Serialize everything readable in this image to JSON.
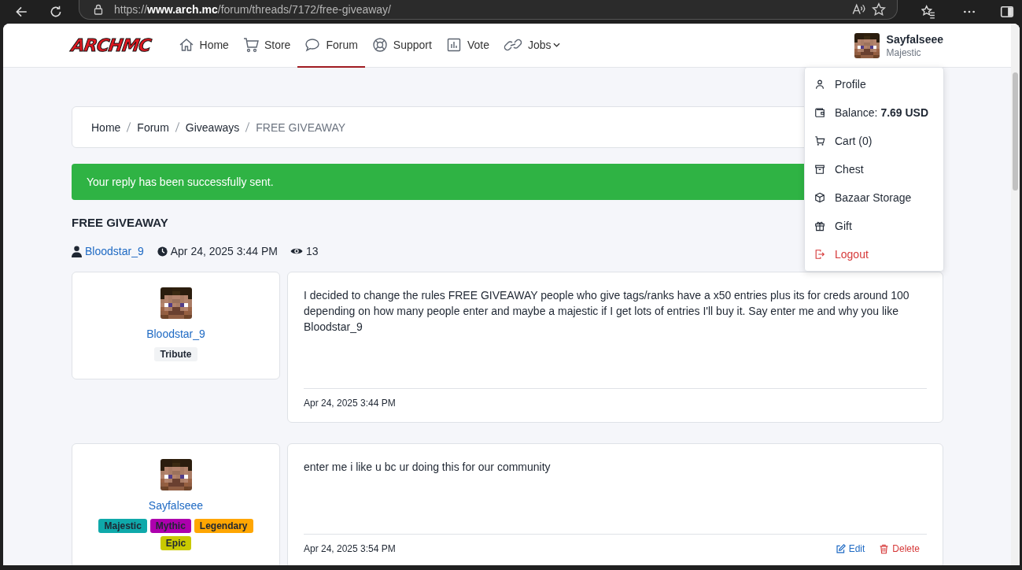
{
  "browser": {
    "url_scheme": "https://",
    "url_host": "www.arch.mc",
    "url_path": "/forum/threads/7172/free-giveaway/"
  },
  "nav": {
    "logo": "ARCHMC",
    "items": [
      {
        "label": "Home",
        "selected": false,
        "has_menu": false
      },
      {
        "label": "Store",
        "selected": false,
        "has_menu": false
      },
      {
        "label": "Forum",
        "selected": true,
        "has_menu": false
      },
      {
        "label": "Support",
        "selected": false,
        "has_menu": false
      },
      {
        "label": "Vote",
        "selected": false,
        "has_menu": false
      },
      {
        "label": "Jobs",
        "selected": false,
        "has_menu": true
      }
    ],
    "user": {
      "name": "Sayfalseee",
      "rank": "Majestic"
    }
  },
  "user_menu": [
    {
      "label": "Profile",
      "kind": "normal"
    },
    {
      "label": "Balance: **7.69 USD**",
      "kind": "normal"
    },
    {
      "label": "Cart (0)",
      "kind": "normal"
    },
    {
      "label": "Chest",
      "kind": "normal"
    },
    {
      "label": "Bazaar Storage",
      "kind": "normal"
    },
    {
      "label": "Gift",
      "kind": "normal"
    },
    {
      "label": "Logout",
      "kind": "danger"
    }
  ],
  "breadcrumb": [
    {
      "label": "Home",
      "current": false
    },
    {
      "label": "Forum",
      "current": false
    },
    {
      "label": "Giveaways",
      "current": false
    },
    {
      "label": "FREE GIVEAWAY",
      "current": true
    }
  ],
  "alert": "Your reply has been successfully sent.",
  "thread": {
    "title": "FREE GIVEAWAY",
    "author": "Bloodstar_9",
    "date": "Apr 24, 2025 3:44 PM",
    "views": "13"
  },
  "posts": [
    {
      "author": "Bloodstar_9",
      "ranks": [
        {
          "label": "Tribute",
          "color": "#f1f3f5"
        }
      ],
      "body": "I decided to change the rules FREE GIVEAWAY people who give tags/ranks have a x50 entries plus its for creds around 100 depending on how many people enter and maybe a majestic if I get lots of entries I'll buy it.  Say enter me and why you like Bloodstar_9",
      "date": "Apr 24, 2025 3:44 PM"
    },
    {
      "author": "Sayfalseee",
      "ranks": [
        {
          "label": "Majestic",
          "color": "#0fa9aa"
        },
        {
          "label": "Mythic",
          "color": "#ad00ad"
        },
        {
          "label": "Legendary",
          "color": "#ffa602"
        },
        {
          "label": "Epic",
          "color": "#c9c900"
        }
      ],
      "body": "enter me i like u bc ur doing this for our community",
      "date": "Apr 24, 2025 3:54 PM",
      "actions": [
        {
          "label": "Edit",
          "kind": "edit"
        },
        {
          "label": "Delete",
          "kind": "delete"
        }
      ]
    }
  ]
}
